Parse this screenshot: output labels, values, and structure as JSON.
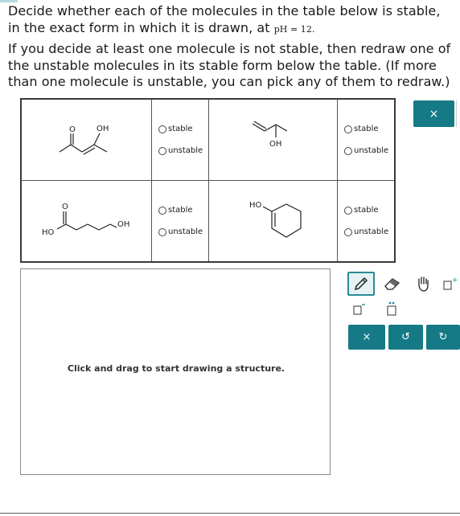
{
  "question": {
    "line1_text": "Decide whether each of the molecules in the table below is stable, in the exact form in which it is drawn, at ",
    "ph_label": "pH = 12.",
    "instructions": "If you decide at least one molecule is not stable, then redraw one of the unstable molecules in its stable form below the table. (If more than one molecule is unstable, you can pick any of them to redraw.)"
  },
  "table": {
    "rows": [
      {
        "left_mol": {
          "labels": {
            "o": "O",
            "oh": "OH"
          }
        },
        "left_options": [
          "stable",
          "unstable"
        ],
        "right_mol": {
          "labels": {
            "oh": "OH"
          }
        },
        "right_options": [
          "stable",
          "unstable"
        ]
      },
      {
        "left_mol": {
          "labels": {
            "o": "O",
            "ho": "HO",
            "oh": "OH"
          }
        },
        "left_options": [
          "stable",
          "unstable"
        ],
        "right_mol": {
          "labels": {
            "ho": "HO"
          }
        },
        "right_options": [
          "stable",
          "unstable"
        ]
      }
    ]
  },
  "close_button_label": "×",
  "canvas": {
    "hint": "Click and drag to start drawing a structure."
  },
  "toolbar": {
    "tools": [
      "pencil-icon",
      "eraser-icon",
      "hand-icon",
      "positive-charge-icon",
      "negative-charge-icon",
      "lone-pair-icon"
    ],
    "clear_label": "×",
    "undo_label": "↺",
    "redo_label": "↻"
  },
  "colors": {
    "accent": "#157a86",
    "accent_light": "#e6f3f5"
  }
}
